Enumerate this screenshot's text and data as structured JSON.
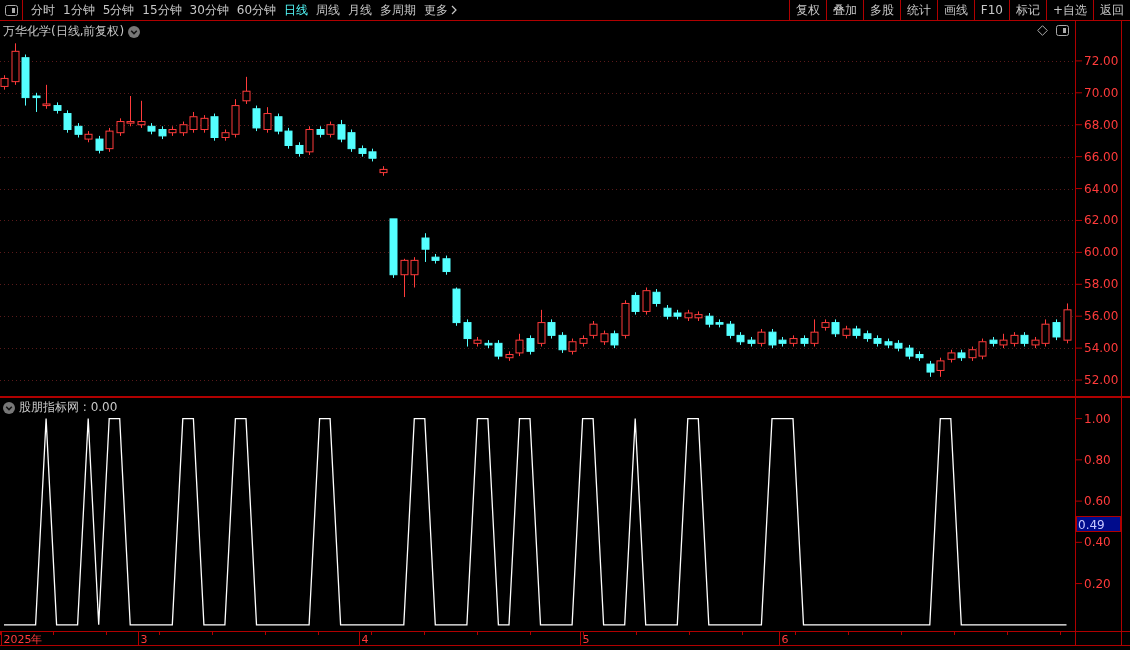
{
  "toolbar": {
    "tabs": [
      {
        "label": "分时",
        "selected": false
      },
      {
        "label": "1分钟",
        "selected": false
      },
      {
        "label": "5分钟",
        "selected": false
      },
      {
        "label": "15分钟",
        "selected": false
      },
      {
        "label": "30分钟",
        "selected": false
      },
      {
        "label": "60分钟",
        "selected": false
      },
      {
        "label": "日线",
        "selected": true
      },
      {
        "label": "周线",
        "selected": false
      },
      {
        "label": "月线",
        "selected": false
      },
      {
        "label": "多周期",
        "selected": false
      }
    ],
    "more": "更多",
    "buttons": [
      "复权",
      "叠加",
      "多股",
      "统计",
      "画线",
      "F10",
      "标记",
      "+自选",
      "返回"
    ]
  },
  "price_pane": {
    "title": "万华化学(日线,前复权)",
    "chart_data": {
      "type": "candlestick",
      "ylim": [
        51,
        74.5
      ],
      "yticks": [
        {
          "value": 52,
          "label": "52.00"
        },
        {
          "value": 54,
          "label": "54.00"
        },
        {
          "value": 56,
          "label": "56.00"
        },
        {
          "value": 58,
          "label": "58.00"
        },
        {
          "value": 60,
          "label": "60.00"
        },
        {
          "value": 62,
          "label": "62.00"
        },
        {
          "value": 64,
          "label": "64.00"
        },
        {
          "value": 66,
          "label": "66.00"
        },
        {
          "value": 68,
          "label": "68.00"
        },
        {
          "value": 70,
          "label": "70.00"
        },
        {
          "value": 72,
          "label": "72.00"
        }
      ],
      "grid": true,
      "ohlc": [
        [
          70.4,
          71.1,
          70.2,
          70.9
        ],
        [
          70.7,
          73.1,
          70.5,
          72.6
        ],
        [
          72.2,
          72.4,
          69.2,
          69.7
        ],
        [
          69.8,
          70.0,
          68.8,
          69.7
        ],
        [
          69.2,
          70.5,
          69.0,
          69.3
        ],
        [
          69.2,
          69.4,
          68.7,
          68.9
        ],
        [
          68.7,
          68.9,
          67.5,
          67.7
        ],
        [
          67.9,
          68.1,
          67.2,
          67.4
        ],
        [
          67.1,
          67.6,
          66.9,
          67.4
        ],
        [
          67.1,
          67.3,
          66.2,
          66.4
        ],
        [
          66.5,
          67.8,
          66.3,
          67.6
        ],
        [
          67.5,
          68.4,
          67.3,
          68.2
        ],
        [
          68.1,
          69.8,
          67.9,
          68.2
        ],
        [
          68.0,
          69.5,
          67.8,
          68.2
        ],
        [
          67.9,
          68.1,
          67.4,
          67.6
        ],
        [
          67.7,
          67.9,
          67.1,
          67.3
        ],
        [
          67.5,
          67.9,
          67.3,
          67.7
        ],
        [
          67.5,
          68.2,
          67.3,
          68.0
        ],
        [
          67.7,
          68.8,
          67.5,
          68.5
        ],
        [
          67.7,
          68.6,
          67.5,
          68.4
        ],
        [
          68.5,
          68.7,
          67.0,
          67.2
        ],
        [
          67.2,
          67.7,
          67.0,
          67.5
        ],
        [
          67.4,
          69.6,
          67.2,
          69.2
        ],
        [
          69.5,
          71.0,
          69.3,
          70.1
        ],
        [
          69.0,
          69.2,
          67.6,
          67.8
        ],
        [
          67.7,
          69.1,
          67.5,
          68.7
        ],
        [
          68.5,
          68.7,
          67.4,
          67.6
        ],
        [
          67.6,
          67.8,
          66.5,
          66.7
        ],
        [
          66.7,
          66.9,
          66.0,
          66.2
        ],
        [
          66.3,
          67.9,
          66.1,
          67.7
        ],
        [
          67.7,
          67.9,
          67.2,
          67.4
        ],
        [
          67.4,
          68.2,
          67.2,
          68.0
        ],
        [
          68.0,
          68.3,
          66.9,
          67.1
        ],
        [
          67.5,
          67.7,
          66.3,
          66.5
        ],
        [
          66.5,
          66.7,
          66.0,
          66.2
        ],
        [
          66.3,
          66.5,
          65.7,
          65.9
        ],
        [
          65.0,
          65.4,
          64.8,
          65.2
        ],
        [
          62.1,
          62.1,
          58.4,
          58.6
        ],
        [
          58.6,
          59.6,
          57.2,
          59.5
        ],
        [
          58.6,
          59.7,
          57.8,
          59.5
        ],
        [
          60.9,
          61.2,
          59.4,
          60.2
        ],
        [
          59.7,
          59.9,
          59.3,
          59.5
        ],
        [
          59.6,
          59.8,
          58.6,
          58.8
        ],
        [
          57.7,
          57.8,
          55.4,
          55.6
        ],
        [
          55.6,
          55.8,
          54.1,
          54.6
        ],
        [
          54.3,
          54.7,
          54.1,
          54.5
        ],
        [
          54.3,
          54.5,
          54.0,
          54.2
        ],
        [
          54.3,
          54.5,
          53.3,
          53.5
        ],
        [
          53.4,
          53.8,
          53.2,
          53.6
        ],
        [
          53.7,
          54.9,
          53.5,
          54.5
        ],
        [
          54.6,
          54.8,
          53.6,
          53.8
        ],
        [
          54.3,
          56.4,
          54.1,
          55.6
        ],
        [
          55.6,
          55.8,
          54.6,
          54.8
        ],
        [
          54.8,
          55.0,
          53.7,
          53.9
        ],
        [
          53.8,
          54.6,
          53.6,
          54.4
        ],
        [
          54.3,
          54.8,
          54.1,
          54.6
        ],
        [
          54.8,
          55.7,
          54.6,
          55.5
        ],
        [
          54.4,
          55.1,
          54.2,
          54.9
        ],
        [
          54.9,
          55.1,
          54.0,
          54.2
        ],
        [
          54.8,
          57.0,
          54.6,
          56.8
        ],
        [
          57.3,
          57.5,
          56.1,
          56.3
        ],
        [
          56.3,
          57.8,
          56.1,
          57.6
        ],
        [
          57.5,
          57.7,
          56.6,
          56.8
        ],
        [
          56.5,
          56.7,
          55.8,
          56.0
        ],
        [
          56.2,
          56.4,
          55.8,
          56.0
        ],
        [
          55.9,
          56.4,
          55.7,
          56.2
        ],
        [
          55.9,
          56.3,
          55.7,
          56.1
        ],
        [
          56.0,
          56.2,
          55.3,
          55.5
        ],
        [
          55.6,
          55.8,
          55.3,
          55.5
        ],
        [
          55.5,
          55.7,
          54.6,
          54.8
        ],
        [
          54.8,
          55.0,
          54.2,
          54.4
        ],
        [
          54.5,
          54.7,
          54.1,
          54.3
        ],
        [
          54.3,
          55.2,
          54.1,
          55.0
        ],
        [
          55.0,
          55.2,
          54.0,
          54.2
        ],
        [
          54.5,
          54.7,
          54.1,
          54.3
        ],
        [
          54.3,
          54.8,
          54.1,
          54.6
        ],
        [
          54.6,
          54.8,
          54.1,
          54.3
        ],
        [
          54.3,
          55.8,
          54.1,
          55.0
        ],
        [
          55.3,
          55.8,
          55.1,
          55.6
        ],
        [
          55.6,
          55.8,
          54.7,
          54.9
        ],
        [
          54.8,
          55.4,
          54.6,
          55.2
        ],
        [
          55.2,
          55.4,
          54.6,
          54.8
        ],
        [
          54.9,
          55.1,
          54.4,
          54.6
        ],
        [
          54.6,
          54.8,
          54.1,
          54.3
        ],
        [
          54.4,
          54.6,
          54.0,
          54.2
        ],
        [
          54.3,
          54.5,
          53.8,
          54.0
        ],
        [
          54.0,
          54.2,
          53.3,
          53.5
        ],
        [
          53.6,
          53.8,
          53.2,
          53.4
        ],
        [
          53.0,
          53.2,
          52.2,
          52.5
        ],
        [
          52.6,
          53.4,
          52.2,
          53.2
        ],
        [
          53.3,
          53.9,
          53.1,
          53.7
        ],
        [
          53.7,
          53.9,
          53.2,
          53.4
        ],
        [
          53.4,
          54.1,
          53.2,
          53.9
        ],
        [
          53.5,
          54.6,
          53.3,
          54.4
        ],
        [
          54.5,
          54.7,
          54.1,
          54.3
        ],
        [
          54.2,
          54.9,
          54.0,
          54.5
        ],
        [
          54.3,
          55.0,
          54.1,
          54.8
        ],
        [
          54.8,
          55.0,
          54.1,
          54.3
        ],
        [
          54.2,
          54.7,
          54.0,
          54.5
        ],
        [
          54.3,
          55.8,
          54.1,
          55.5
        ],
        [
          55.6,
          55.8,
          54.5,
          54.7
        ],
        [
          54.5,
          56.8,
          54.3,
          56.4
        ]
      ]
    }
  },
  "date_axis": [
    "2025年",
    "3",
    "4",
    "5",
    "6"
  ],
  "indicator_pane": {
    "legend": "股朋指标网 : 0.00",
    "current_value": "0.49",
    "chart_data": {
      "type": "line",
      "ylim": [
        -0.03,
        1.1
      ],
      "yticks": [
        {
          "value": 0.2,
          "label": "0.20"
        },
        {
          "value": 0.4,
          "label": "0.40"
        },
        {
          "value": 0.6,
          "label": "0.60"
        },
        {
          "value": 0.8,
          "label": "0.80"
        },
        {
          "value": 1.0,
          "label": "1.00"
        }
      ],
      "series": [
        {
          "color": "#ffffff",
          "values": [
            0,
            0,
            0,
            0,
            1,
            0,
            0,
            0,
            1,
            0,
            1,
            1,
            0,
            0,
            0,
            0,
            0,
            1,
            1,
            0,
            0,
            0,
            1,
            1,
            0,
            0,
            0,
            0,
            0,
            0,
            1,
            1,
            0,
            0,
            0,
            0,
            0,
            0,
            0,
            1,
            1,
            0,
            0,
            0,
            0,
            1,
            1,
            0,
            0,
            1,
            1,
            0,
            0,
            0,
            0,
            1,
            1,
            0,
            0,
            0,
            1,
            0,
            0,
            0,
            0,
            1,
            1,
            0,
            0,
            0,
            0,
            0,
            0,
            1,
            1,
            1,
            0,
            0,
            0,
            0,
            0,
            0,
            0,
            0,
            0,
            0,
            0,
            0,
            0,
            1,
            1,
            0,
            0,
            0,
            0,
            0,
            0,
            0,
            0,
            0,
            0,
            0
          ]
        }
      ]
    }
  }
}
